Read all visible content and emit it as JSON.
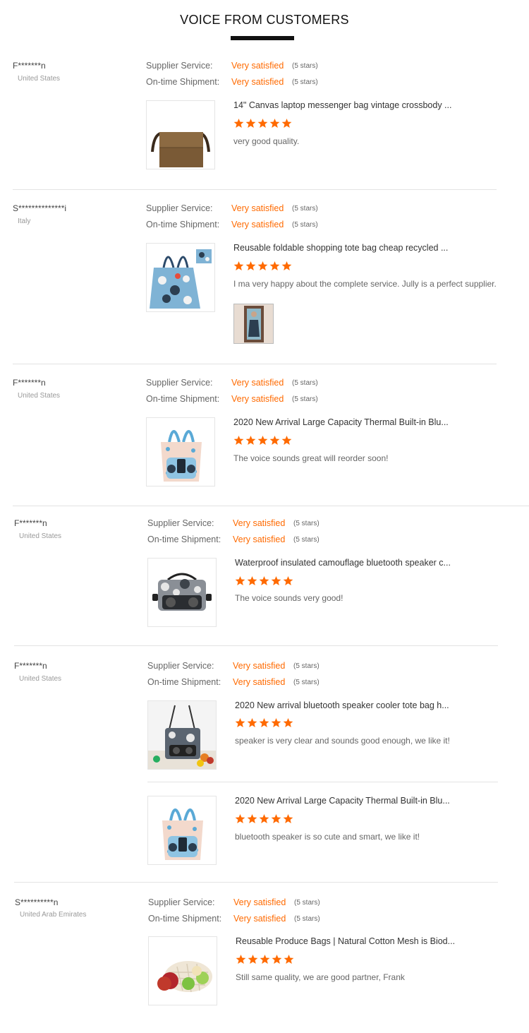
{
  "header": {
    "title": "VOICE FROM CUSTOMERS"
  },
  "labels": {
    "supplier_service": "Supplier Service:",
    "shipment": "On-time Shipment:"
  },
  "accent_color": "#ff6a00",
  "reviews": [
    {
      "name": "F*******n",
      "country": "United States",
      "supplier_rating": "Very satisfied",
      "supplier_stars": "(5 stars)",
      "shipment_rating": "Very satisfied",
      "shipment_stars": "(5 stars)",
      "products": [
        {
          "title": "14\" Canvas laptop messenger bag vintage crossbody ...",
          "stars": 5,
          "comment": "very good quality.",
          "image_icon": "messenger-bag"
        }
      ]
    },
    {
      "name": "S**************i",
      "country": "Italy",
      "supplier_rating": "Very satisfied",
      "supplier_stars": "(5 stars)",
      "shipment_rating": "Very satisfied",
      "shipment_stars": "(5 stars)",
      "products": [
        {
          "title": "Reusable foldable shopping tote bag cheap recycled ...",
          "stars": 5,
          "comment": "I ma very happy about the complete service. Jully is a perfect supplier.",
          "image_icon": "tote-bag",
          "has_photo": true
        }
      ]
    },
    {
      "name": "F*******n",
      "country": "United States",
      "supplier_rating": "Very satisfied",
      "supplier_stars": "(5 stars)",
      "shipment_rating": "Very satisfied",
      "shipment_stars": "(5 stars)",
      "products": [
        {
          "title": "2020 New Arrival Large Capacity Thermal Built-in Blu...",
          "stars": 5,
          "comment": "The voice sounds great will reorder soon!",
          "image_icon": "speaker-tote"
        }
      ]
    },
    {
      "name": "F*******n",
      "country": "United States",
      "supplier_rating": "Very satisfied",
      "supplier_stars": "(5 stars)",
      "shipment_rating": "Very satisfied",
      "shipment_stars": "(5 stars)",
      "products": [
        {
          "title": "Waterproof insulated camouflage bluetooth speaker c...",
          "stars": 5,
          "comment": "The voice sounds very good!",
          "image_icon": "camo-cooler"
        }
      ]
    },
    {
      "name": "F*******n",
      "country": "United States",
      "supplier_rating": "Very satisfied",
      "supplier_stars": "(5 stars)",
      "shipment_rating": "Very satisfied",
      "shipment_stars": "(5 stars)",
      "products": [
        {
          "title": "2020 New arrival bluetooth speaker cooler tote bag h...",
          "stars": 5,
          "comment": "speaker is very clear and sounds good enough, we like it!",
          "image_icon": "cooler-tote"
        },
        {
          "title": "2020 New Arrival Large Capacity Thermal Built-in Blu...",
          "stars": 5,
          "comment": "bluetooth speaker is so cute and smart, we like it!",
          "image_icon": "speaker-tote"
        }
      ]
    },
    {
      "name": "S**********n",
      "country": "United Arab Emirates",
      "supplier_rating": "Very satisfied",
      "supplier_stars": "(5 stars)",
      "shipment_rating": "Very satisfied",
      "shipment_stars": "(5 stars)",
      "products": [
        {
          "title": "Reusable Produce Bags | Natural Cotton Mesh is Biod...",
          "stars": 5,
          "comment": "Still same quality, we are good partner, Frank",
          "image_icon": "produce-bag"
        }
      ]
    }
  ]
}
